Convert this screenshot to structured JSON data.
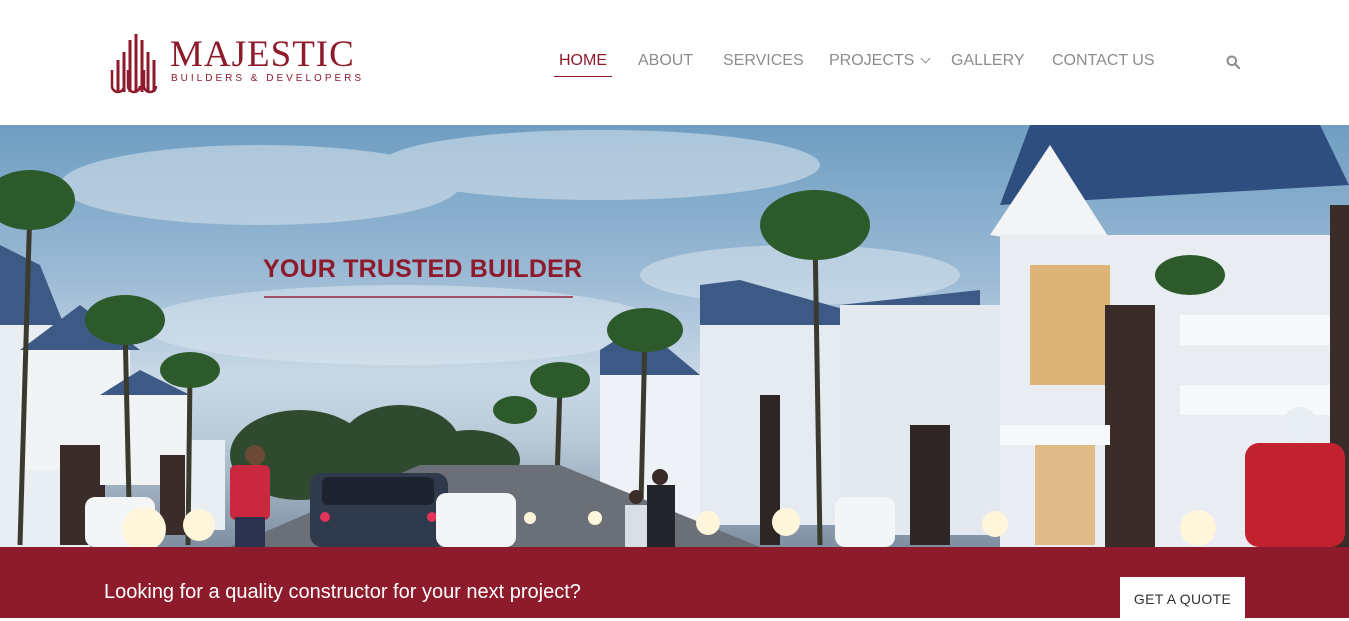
{
  "brand": {
    "name": "MAJESTIC",
    "tagline": "BUILDERS & DEVELOPERS",
    "color": "#8e1b2c"
  },
  "nav": {
    "items": [
      {
        "label": "HOME",
        "active": true
      },
      {
        "label": "ABOUT"
      },
      {
        "label": "SERVICES"
      },
      {
        "label": "PROJECTS",
        "has_dropdown": true
      },
      {
        "label": "GALLERY"
      },
      {
        "label": "CONTACT US"
      }
    ],
    "search_icon": "search-icon"
  },
  "hero": {
    "title": "YOUR TRUSTED BUILDER"
  },
  "cta": {
    "text": "Looking for a quality constructor for your next project?",
    "button_label": "GET A QUOTE"
  }
}
